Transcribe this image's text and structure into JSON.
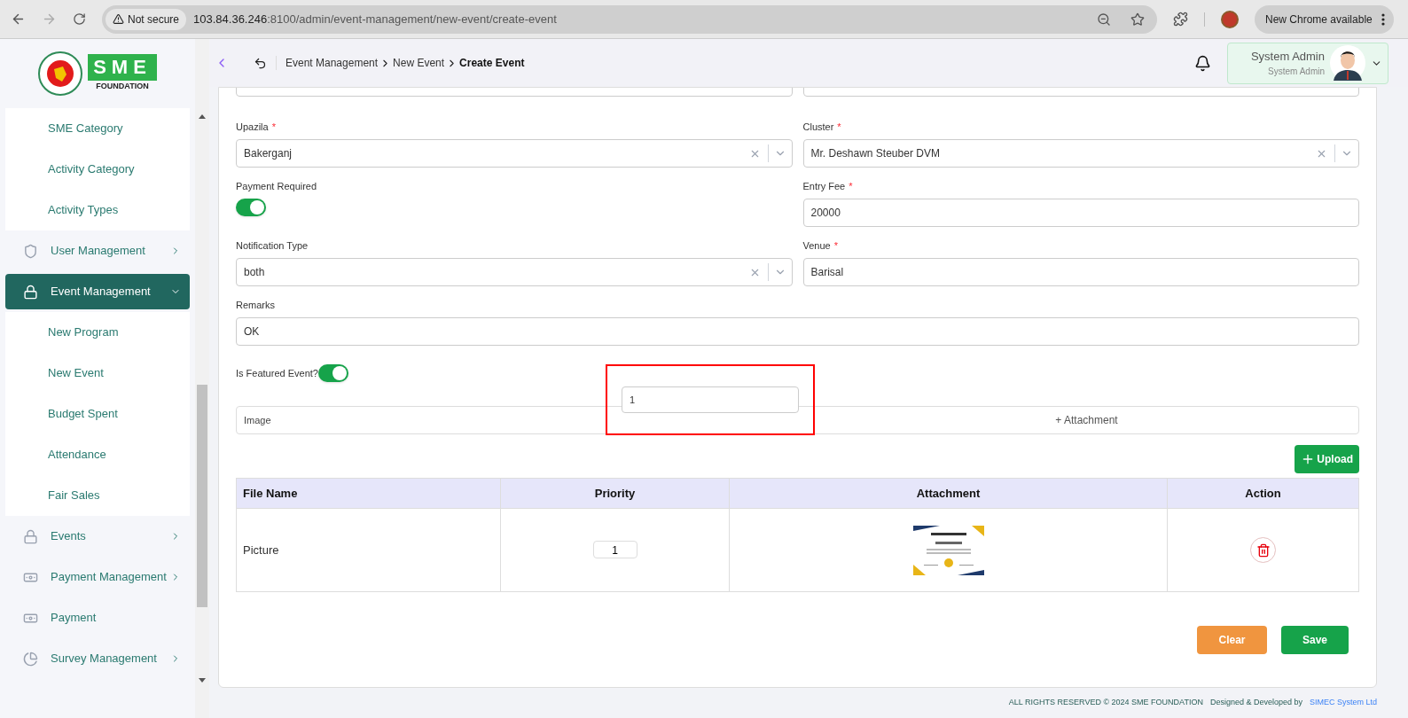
{
  "browser": {
    "security": "Not secure",
    "url_host": "103.84.36.246",
    "url_rest": ":8100/admin/event-management/new-event/create-event",
    "update": "New Chrome available"
  },
  "logo": {
    "mark": "SME",
    "subtitle": "FOUNDATION"
  },
  "sidebar": {
    "items": [
      {
        "kind": "submenu",
        "children": [
          {
            "label": "SME Category",
            "selected": false
          },
          {
            "label": "Activity Category",
            "selected": false
          },
          {
            "label": "Activity Types",
            "selected": false
          }
        ]
      },
      {
        "kind": "menu",
        "label": "User Management",
        "selected": false,
        "expanded": false
      },
      {
        "kind": "menu",
        "label": "Event Management",
        "selected": true,
        "expanded": true,
        "children": [
          {
            "label": "New Program",
            "selected": false
          },
          {
            "label": "New Event",
            "selected": false
          },
          {
            "label": "Budget Spent",
            "selected": false
          },
          {
            "label": "Attendance",
            "selected": false
          },
          {
            "label": "Fair Sales",
            "selected": false
          }
        ]
      },
      {
        "kind": "menu",
        "label": "Events",
        "selected": false,
        "expanded": false
      },
      {
        "kind": "menu",
        "label": "Payment Management",
        "selected": false,
        "expanded": false
      },
      {
        "kind": "menu",
        "label": "Payment",
        "selected": false
      },
      {
        "kind": "menu",
        "label": "Survey Management",
        "selected": false,
        "expanded": false
      }
    ]
  },
  "header": {
    "breadcrumbs": [
      {
        "label": "Event Management",
        "current": false
      },
      {
        "label": "New Event",
        "current": false
      },
      {
        "label": "Create Event",
        "current": true
      }
    ],
    "user": {
      "name": "System Admin",
      "role": "System Admin"
    }
  },
  "form": {
    "required_mark": "*",
    "rows": [
      [
        {
          "kind": "select",
          "label": "Upazila",
          "required": true,
          "value": "Bakerganj"
        },
        {
          "kind": "select",
          "label": "Cluster",
          "required": true,
          "value": "Mr. Deshawn Steuber DVM"
        }
      ],
      [
        {
          "kind": "toggle",
          "label": "Payment Required",
          "required": false,
          "on": true
        },
        {
          "kind": "text",
          "label": "Entry Fee",
          "required": true,
          "value": "20000"
        }
      ],
      [
        {
          "kind": "select",
          "label": "Notification Type",
          "required": false,
          "value": "both"
        },
        {
          "kind": "text",
          "label": "Venue",
          "required": true,
          "value": "Barisal"
        }
      ],
      [
        {
          "kind": "text",
          "label": "Remarks",
          "required": false,
          "value": "OK"
        }
      ]
    ],
    "featured": {
      "label": "Is Featured Event?",
      "on": true
    },
    "attachment": {
      "name": "Image",
      "priority": "1",
      "attach": "+ Attachment"
    },
    "upload": "Upload"
  },
  "table": {
    "columns": [
      "File Name",
      "Priority",
      "Attachment",
      "Action"
    ],
    "rows": [
      {
        "file_name": "Picture",
        "priority": "1"
      }
    ]
  },
  "actions": {
    "clear": "Clear",
    "save": "Save"
  },
  "footer": {
    "copyright": "ALL RIGHTS RESERVED © 2024 SME FOUNDATION",
    "designed_by": "Designed & Developed by",
    "company": "SIMEC System Ltd"
  }
}
